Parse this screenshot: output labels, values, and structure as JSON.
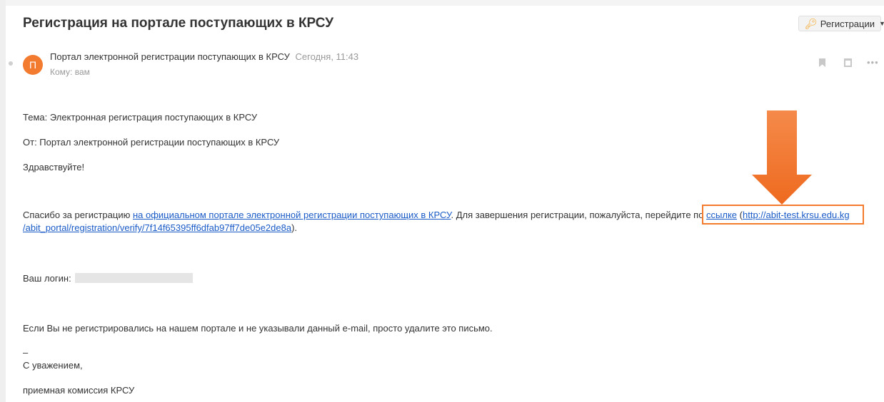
{
  "email": {
    "subject": "Регистрация на портале поступающих в КРСУ",
    "folder_label": "Регистрации",
    "sender_initial": "П",
    "sender_name": "Портал электронной регистрации поступающих в КРСУ",
    "date": "Сегодня, 11:43",
    "recipient": "Кому: вам"
  },
  "body": {
    "topic": "Тема: Электронная регистрация поступающих в КРСУ",
    "from": "От: Портал электронной регистрации поступающих в КРСУ",
    "greeting": "Здравствуйте!",
    "thanks_prefix": "Спасибо за регистрацию ",
    "portal_link": "на официальном портале электронной регистрации поступающих в КРСУ",
    "thanks_middle": ". Для завершения регистрации, пожалуйста, перейдите по ",
    "link_word": "ссылке",
    "paren_open": " (",
    "url_part1": "http://abit-test.krsu.edu.kg",
    "url_part2": "/abit_portal/registration/verify/7f14f65395ff6dfab97ff7de05e2de8a",
    "paren_close": ").",
    "login_label": "Ваш логин:",
    "ignore_notice": "Если Вы не регистрировались на нашем портале и не указывали данный e-mail, просто удалите это письмо.",
    "separator": "–",
    "regards": "С уважением,",
    "signature": "приемная комиссия КРСУ"
  },
  "colors": {
    "accent_orange": "#f27b30",
    "link_blue": "#1a5bc7"
  },
  "icons": [
    "key-icon",
    "caret-down-icon",
    "bookmark-icon",
    "calendar-icon",
    "more-icon",
    "arrow-down-icon"
  ]
}
